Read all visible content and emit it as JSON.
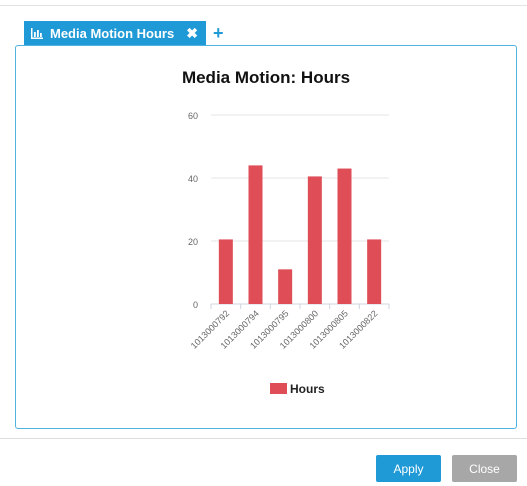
{
  "tab": {
    "label": "Media Motion Hours",
    "close_icon": "close-x-icon",
    "chart_icon": "bar-chart-icon"
  },
  "add_tab": {
    "label": "+"
  },
  "buttons": {
    "apply": "Apply",
    "close": "Close"
  },
  "colors": {
    "accent": "#1f9ad6",
    "bar": "#df4d56",
    "close_button": "#a7a7a7"
  },
  "chart_data": {
    "type": "bar",
    "title": "Media Motion: Hours",
    "categories": [
      "1013000792",
      "1013000794",
      "1013000795",
      "1013000800",
      "1013000805",
      "1013000822"
    ],
    "series": [
      {
        "name": "Hours",
        "values": [
          20.5,
          44,
          11,
          40.5,
          43,
          20.5
        ]
      }
    ],
    "ylim": [
      0,
      60
    ],
    "yticks": [
      0,
      20,
      40,
      60
    ],
    "grid": true,
    "legend_position": "bottom-center"
  }
}
